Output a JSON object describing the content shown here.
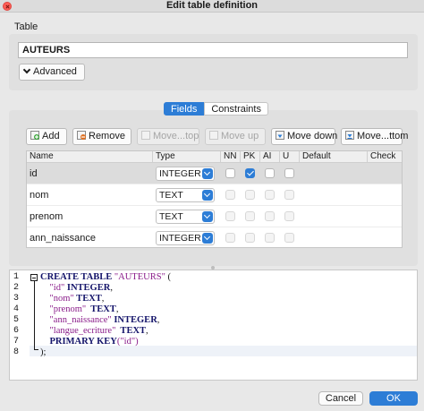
{
  "window": {
    "title": "Edit table definition"
  },
  "table_section": {
    "label": "Table",
    "name_value": "AUTEURS",
    "advanced_label": "Advanced"
  },
  "tabs": [
    {
      "label": "Fields",
      "active": true
    },
    {
      "label": "Constraints",
      "active": false
    }
  ],
  "toolbar": {
    "add": "Add",
    "remove": "Remove",
    "move_top": "Move...top",
    "move_up": "Move up",
    "move_down": "Move down",
    "move_bottom": "Move...ttom"
  },
  "grid": {
    "columns": [
      "Name",
      "Type",
      "NN",
      "PK",
      "AI",
      "U",
      "Default",
      "Check"
    ],
    "rows": [
      {
        "name": "id",
        "type": "INTEGER",
        "nn": false,
        "pk": true,
        "ai": false,
        "u": false,
        "selected": true
      },
      {
        "name": "nom",
        "type": "TEXT",
        "nn": false,
        "pk": false,
        "ai": false,
        "u": false,
        "selected": false
      },
      {
        "name": "prenom",
        "type": "TEXT",
        "nn": false,
        "pk": false,
        "ai": false,
        "u": false,
        "selected": false
      },
      {
        "name": "ann_naissance",
        "type": "INTEGER",
        "nn": false,
        "pk": false,
        "ai": false,
        "u": false,
        "selected": false
      }
    ]
  },
  "sql": {
    "line_numbers": [
      "1",
      "2",
      "3",
      "4",
      "5",
      "6",
      "7",
      "8"
    ],
    "lines": [
      {
        "kw": "CREATE TABLE ",
        "str": "\"AUTEURS\"",
        "tail": " ("
      },
      {
        "indent": "    ",
        "str": "\"id\"",
        "kw": " INTEGER",
        "tail": ","
      },
      {
        "indent": "    ",
        "str": "\"nom\"",
        "kw": " TEXT",
        "tail": ","
      },
      {
        "indent": "    ",
        "str": "\"prenom\"",
        "kw": "  TEXT",
        "tail": ","
      },
      {
        "indent": "    ",
        "str": "\"ann_naissance\"",
        "kw": " INTEGER",
        "tail": ","
      },
      {
        "indent": "    ",
        "str": "\"langue_ecriture\"",
        "kw": "  TEXT",
        "tail": ","
      },
      {
        "indent": "    ",
        "kw": "PRIMARY KEY",
        "str": "(\"id\")",
        "tail": ""
      },
      {
        "indent": "",
        "kw": "",
        "str": "",
        "tail": ");"
      }
    ]
  },
  "footer": {
    "cancel": "Cancel",
    "ok": "OK"
  },
  "colors": {
    "accent": "#2d7dd6",
    "keyword": "#14146a",
    "string": "#8a1c8a"
  }
}
